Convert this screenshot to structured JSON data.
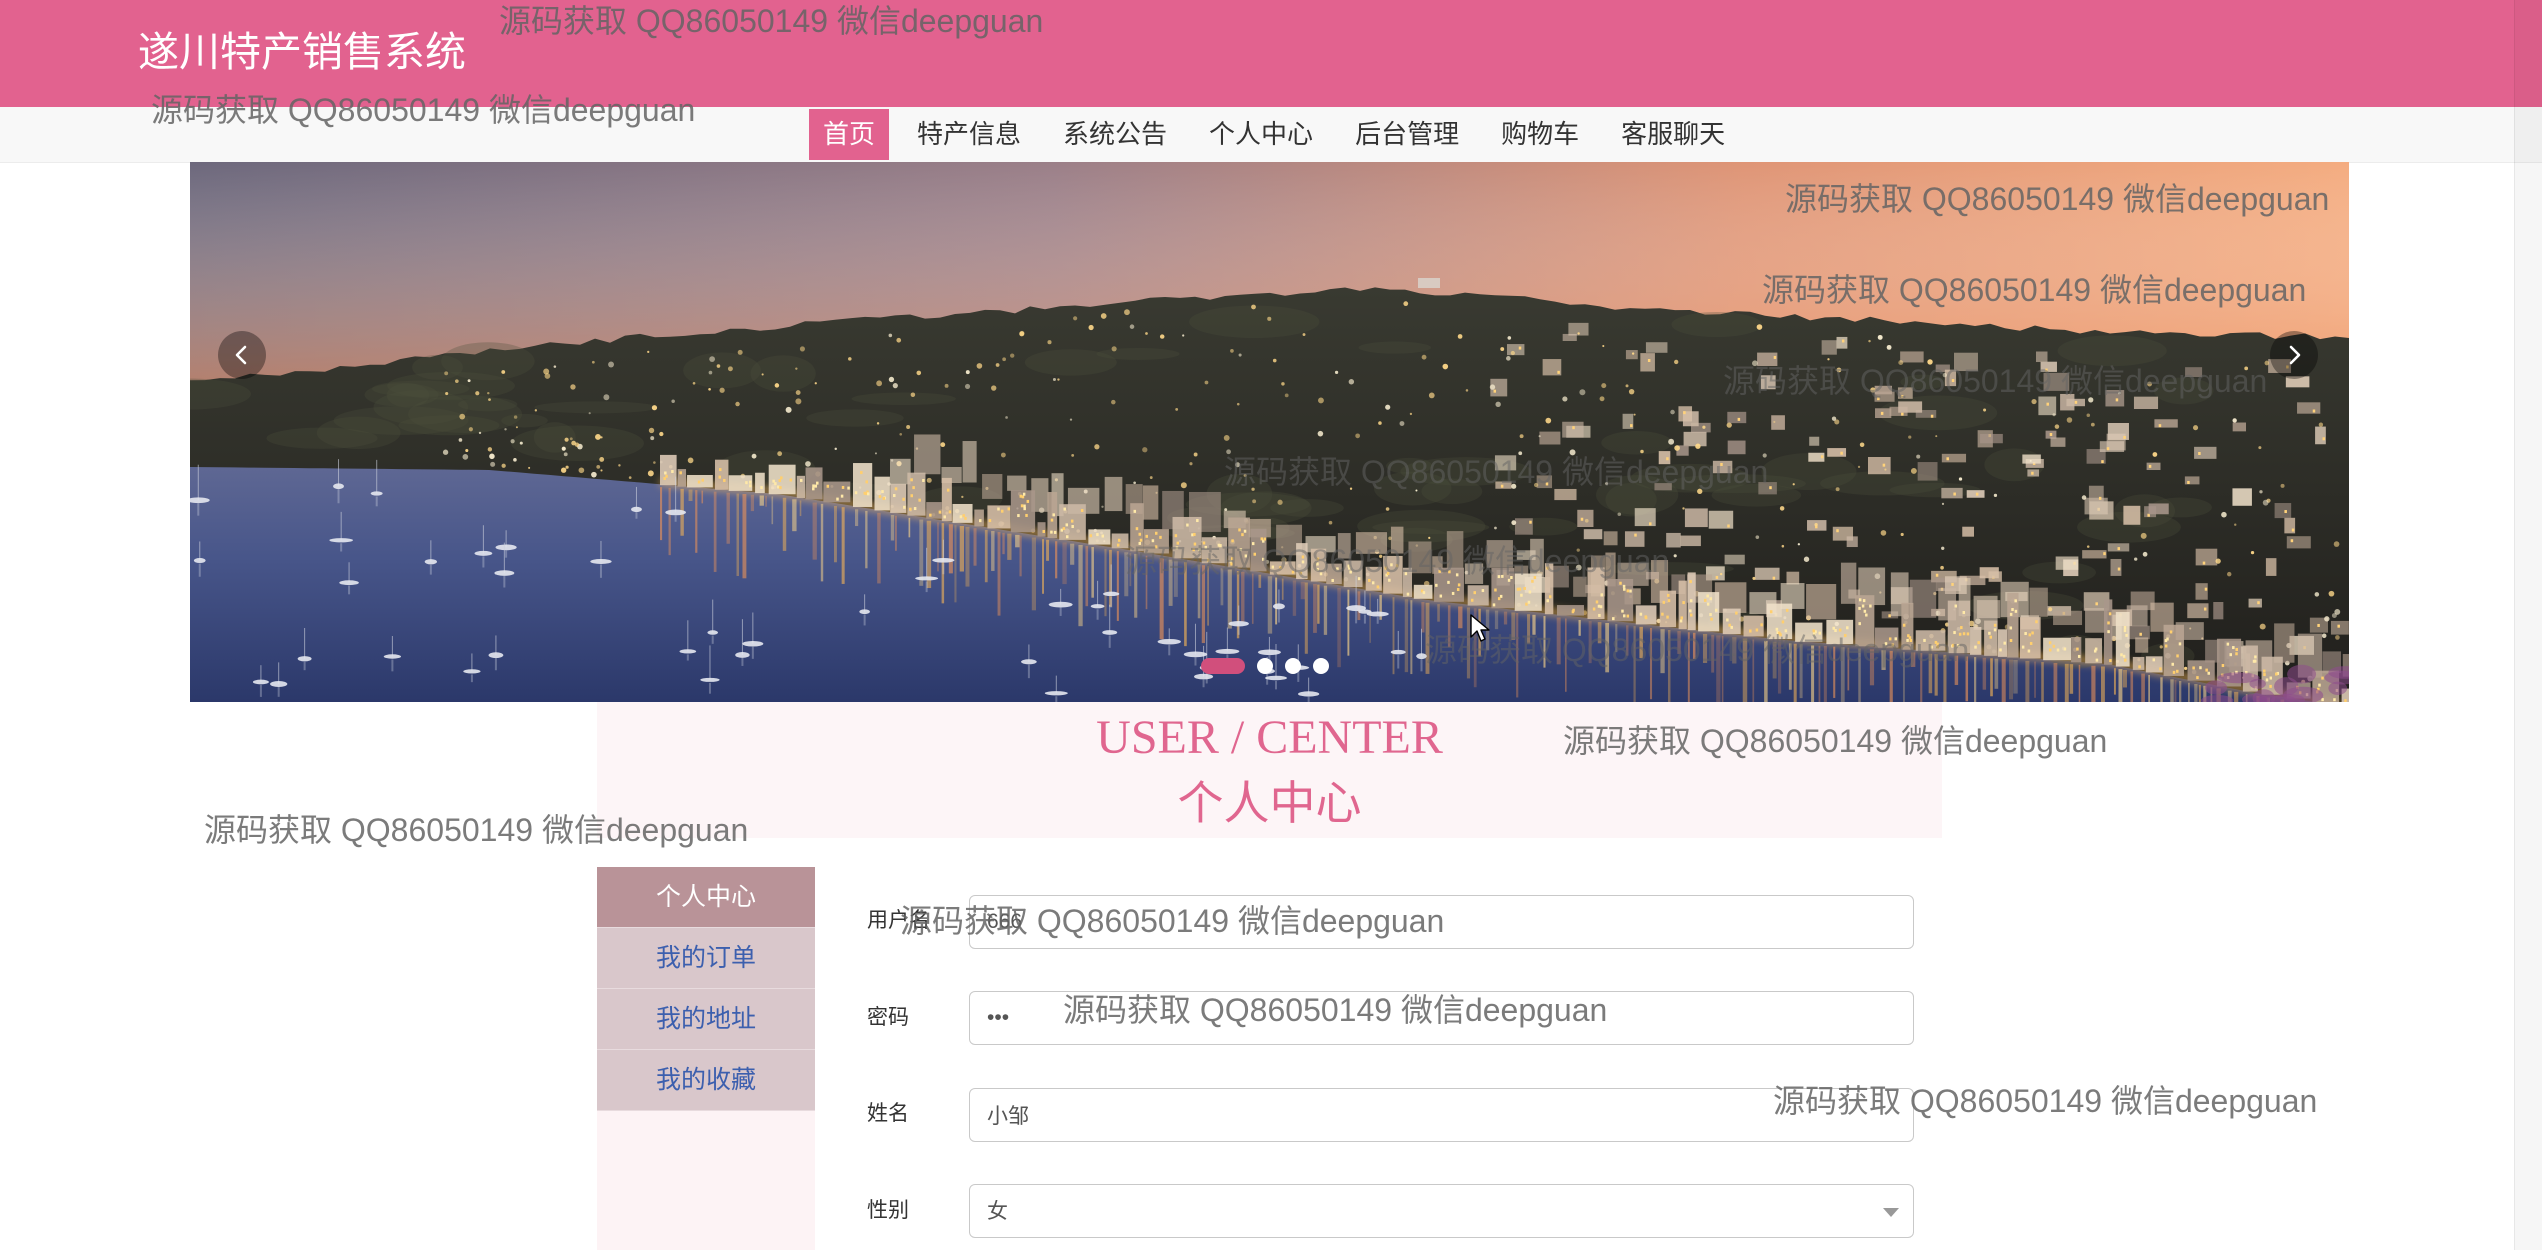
{
  "app": {
    "title": "遂川特产销售系统"
  },
  "watermark": "源码获取 QQ86050149 微信deepguan",
  "nav": {
    "items": [
      {
        "label": "首页",
        "active": true
      },
      {
        "label": "特产信息",
        "active": false
      },
      {
        "label": "系统公告",
        "active": false
      },
      {
        "label": "个人中心",
        "active": false
      },
      {
        "label": "后台管理",
        "active": false
      },
      {
        "label": "购物车",
        "active": false
      },
      {
        "label": "客服聊天",
        "active": false
      }
    ]
  },
  "carousel": {
    "slide_count": 4,
    "active_slide": 1,
    "prev_icon": "chevron-left-icon",
    "next_icon": "chevron-right-icon"
  },
  "section": {
    "title_en": "USER / CENTER",
    "title_cn": "个人中心"
  },
  "sidebar": {
    "items": [
      {
        "label": "个人中心",
        "active": true
      },
      {
        "label": "我的订单",
        "active": false
      },
      {
        "label": "我的地址",
        "active": false
      },
      {
        "label": "我的收藏",
        "active": false
      }
    ]
  },
  "form": {
    "username": {
      "label": "用户名",
      "value": "666"
    },
    "password": {
      "label": "密码",
      "value": "•••"
    },
    "name": {
      "label": "姓名",
      "value": "小邹"
    },
    "gender": {
      "label": "性别",
      "value": "女",
      "icon": "caret-down-icon"
    }
  },
  "colors": {
    "primary": "#e2628f",
    "nav_bg": "#f8f8f8",
    "sidebar_active": "#b99398",
    "sidebar_item": "#d9c7cb",
    "sidebar_text": "#3c5fae",
    "sidebar_panel": "#fdf3f5",
    "title_pink": "#e0668f",
    "section_bg": "#fdf5f7"
  }
}
